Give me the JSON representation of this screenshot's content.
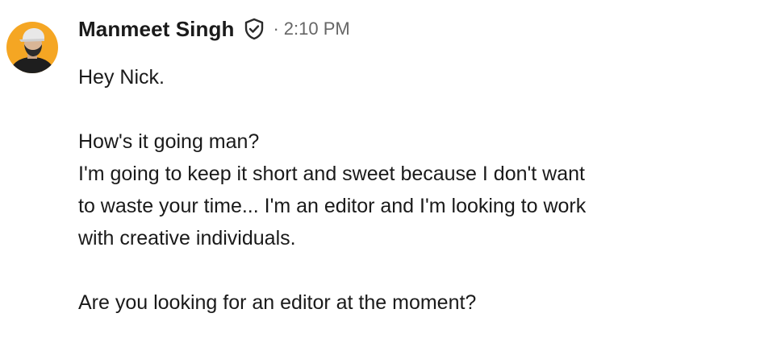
{
  "message": {
    "sender": "Manmeet Singh",
    "separator": "·",
    "timestamp": "2:10 PM",
    "avatar_icon": "user-avatar-photo",
    "verified_icon": "shield-check-icon",
    "accent_color": "#F5A623",
    "lines": [
      "Hey Nick.",
      "How's it going man?",
      "I'm going to keep it short and sweet because I don't want",
      "to waste your time... I'm an editor and I'm looking to work",
      "with creative individuals.",
      "Are you looking for an editor at the moment?"
    ]
  }
}
